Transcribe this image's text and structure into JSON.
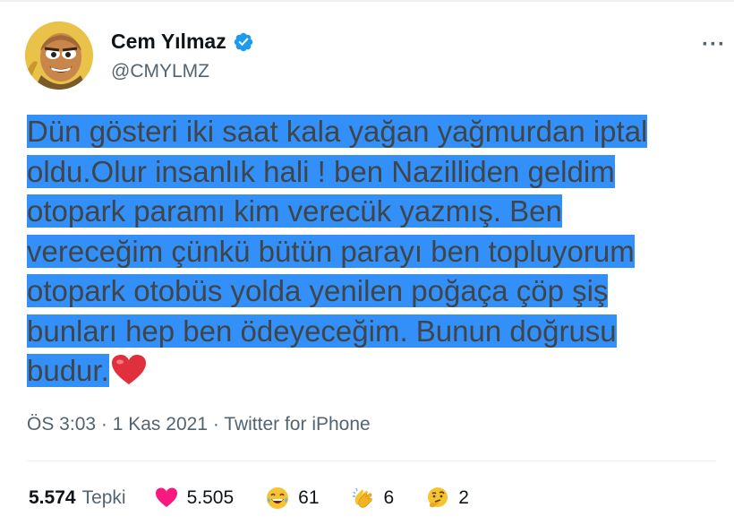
{
  "author": {
    "display_name": "Cem Yılmaz",
    "handle": "@CMYLMZ",
    "verified": true,
    "avatar_icon": "cartoon-avatar"
  },
  "tweet": {
    "lines": [
      "Dün gösteri iki saat kala yağan yağmurdan iptal",
      "oldu.Olur insanlık hali ! ben Nazilliden geldim",
      "otopark paramı kim verecük yazmış. Ben",
      "vereceğim çünkü bütün parayı ben topluyorum",
      "otopark otobüs yolda yenilen poğaça çöp şiş",
      "bunları hep ben ödeyeceğim. Bunun doğrusu",
      "budur."
    ],
    "emoji": "red-heart",
    "highlight_color": "#3390f8"
  },
  "meta": {
    "time": "ÖS 3:03",
    "sep1": " · ",
    "date": "1 Kas 2021",
    "sep2": " · ",
    "source": "Twitter for iPhone"
  },
  "reactions": {
    "total": "5.574",
    "total_label": "Tepki",
    "items": [
      {
        "icon": "heart-icon",
        "count": "5.505"
      },
      {
        "icon": "laughing-emoji-icon",
        "count": "61"
      },
      {
        "icon": "clapping-hands-icon",
        "count": "6"
      },
      {
        "icon": "thinking-emoji-icon",
        "count": "2"
      }
    ]
  },
  "colors": {
    "verified_blue": "#1d9bf0",
    "heart_pink": "#f91880",
    "text_gray": "#536471"
  },
  "more_label": "···"
}
